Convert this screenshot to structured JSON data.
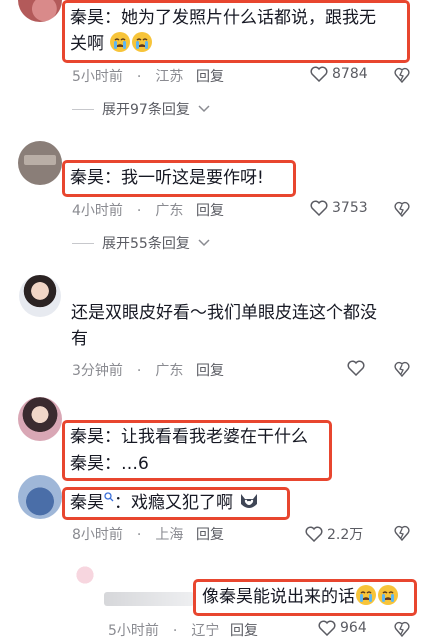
{
  "comments": [
    {
      "text_line1": "秦昊：她为了发照片什么话都说，跟我无",
      "text_line2": "关啊",
      "time": "5小时前",
      "location": "江苏",
      "reply_label": "回复",
      "likes": "8784",
      "expand": "展开97条回复"
    },
    {
      "text": "秦昊：我一听这是要作呀!",
      "time": "4小时前",
      "location": "广东",
      "reply_label": "回复",
      "likes": "3753",
      "expand": "展开55条回复"
    },
    {
      "text_line1": "还是双眼皮好看～我们单眼皮连这个都没",
      "text_line2": "有",
      "time": "3分钟前",
      "location": "广东",
      "reply_label": "回复"
    },
    {
      "text_line1": "秦昊：让我看看我老婆在干什么",
      "text_line2": "秦昊：…6"
    },
    {
      "name": "秦昊",
      "text": "：戏瘾又犯了啊",
      "time": "8小时前",
      "location": "上海",
      "reply_label": "回复",
      "likes": "2.2万"
    },
    {
      "text": "像秦昊能说出来的话",
      "time": "5小时前",
      "location": "辽宁",
      "reply_label": "回复",
      "likes": "964"
    }
  ],
  "colors": {
    "highlight_border": "#e8462f",
    "meta_text": "#8a8b91"
  },
  "icons": [
    "heart-icon",
    "dislike-icon",
    "chevron-down-icon",
    "crying-emoji",
    "dog-emoji",
    "search-icon"
  ]
}
